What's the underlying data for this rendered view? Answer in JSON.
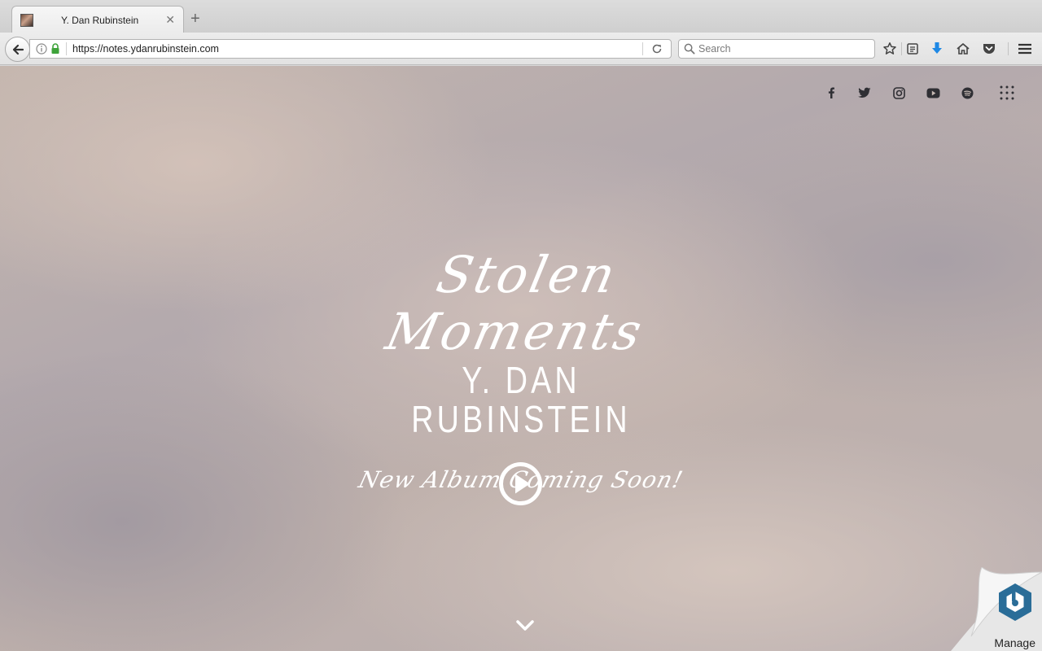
{
  "browser": {
    "tab": {
      "title": "Y. Dan Rubinstein",
      "close_icon": "close-icon"
    },
    "new_tab_label": "+",
    "url": "https://notes.ydanrubinstein.com",
    "search": {
      "placeholder": "Search",
      "value": ""
    },
    "toolbar_icons": [
      "bookmark-star-icon",
      "reading-list-icon",
      "downloads-icon",
      "home-icon",
      "pocket-icon",
      "menu-icon"
    ],
    "accent_colors": {
      "lock": "#3ea33a",
      "downloads": "#1e88e5"
    }
  },
  "page": {
    "social_links": [
      {
        "icon": "facebook-icon"
      },
      {
        "icon": "twitter-icon"
      },
      {
        "icon": "instagram-icon"
      },
      {
        "icon": "youtube-icon"
      },
      {
        "icon": "spotify-icon"
      },
      {
        "icon": "apps-grid-icon"
      }
    ],
    "hero": {
      "title": "Stolen Moments",
      "artist": "Y. DAN RUBINSTEIN",
      "tagline": "New Album Coming Soon!"
    },
    "play_icon": "play-circle-icon",
    "scroll_icon": "chevron-down-icon",
    "manage_widget": {
      "label": "Manage",
      "color": "#2a6d98"
    }
  }
}
